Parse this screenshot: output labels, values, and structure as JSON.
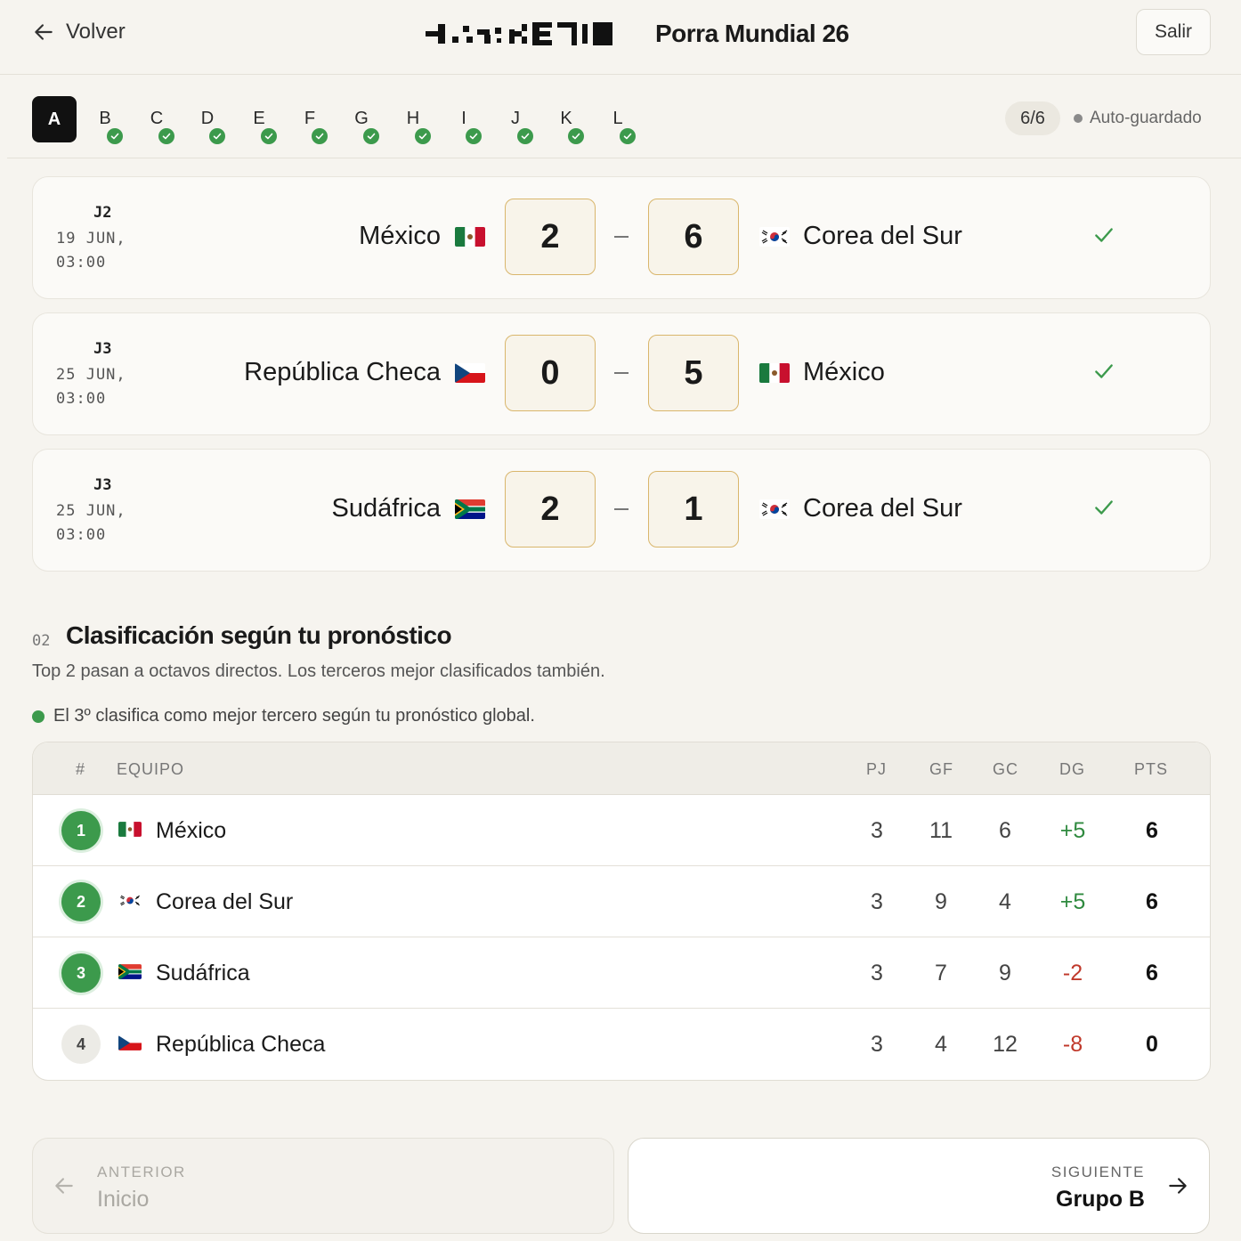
{
  "header": {
    "back_label": "Volver",
    "title": "Porra Mundial 26",
    "logout_label": "Salir"
  },
  "groups": {
    "tabs": [
      "A",
      "B",
      "C",
      "D",
      "E",
      "F",
      "G",
      "H",
      "I",
      "J",
      "K",
      "L"
    ],
    "active": "A",
    "completed": [
      "B",
      "C",
      "D",
      "E",
      "F",
      "G",
      "H",
      "I",
      "J",
      "K",
      "L"
    ],
    "counter": "6/6",
    "autosave": "Auto-guardado"
  },
  "matches": [
    {
      "round": "J2",
      "date": "19 JUN,",
      "time": "03:00",
      "home": "México",
      "home_flag": "mexico-flag-icon",
      "home_score": "2",
      "away_score": "6",
      "away": "Corea del Sur",
      "away_flag": "south-korea-flag-icon"
    },
    {
      "round": "J3",
      "date": "25 JUN,",
      "time": "03:00",
      "home": "República Checa",
      "home_flag": "czech-flag-icon",
      "home_score": "0",
      "away_score": "5",
      "away": "México",
      "away_flag": "mexico-flag-icon"
    },
    {
      "round": "J3",
      "date": "25 JUN,",
      "time": "03:00",
      "home": "Sudáfrica",
      "home_flag": "south-africa-flag-icon",
      "home_score": "2",
      "away_score": "1",
      "away": "Corea del Sur",
      "away_flag": "south-korea-flag-icon"
    }
  ],
  "standings": {
    "section_number": "02",
    "title": "Clasificación según tu pronóstico",
    "subtitle": "Top 2 pasan a octavos directos. Los terceros mejor clasificados también.",
    "note": "El 3º clasifica como mejor tercero según tu pronóstico global.",
    "columns": {
      "pos": "#",
      "team": "EQUIPO",
      "pj": "PJ",
      "gf": "GF",
      "gc": "GC",
      "dg": "DG",
      "pts": "PTS"
    },
    "rows": [
      {
        "pos": "1",
        "team": "México",
        "flag": "mexico-flag-icon",
        "pj": "3",
        "gf": "11",
        "gc": "6",
        "dg": "+5",
        "pts": "6",
        "qualified": true
      },
      {
        "pos": "2",
        "team": "Corea del Sur",
        "flag": "south-korea-flag-icon",
        "pj": "3",
        "gf": "9",
        "gc": "4",
        "dg": "+5",
        "pts": "6",
        "qualified": true
      },
      {
        "pos": "3",
        "team": "Sudáfrica",
        "flag": "south-africa-flag-icon",
        "pj": "3",
        "gf": "7",
        "gc": "9",
        "dg": "-2",
        "pts": "6",
        "qualified": true
      },
      {
        "pos": "4",
        "team": "República Checa",
        "flag": "czech-flag-icon",
        "pj": "3",
        "gf": "4",
        "gc": "12",
        "dg": "-8",
        "pts": "0",
        "qualified": false
      }
    ]
  },
  "pager": {
    "prev_small": "ANTERIOR",
    "prev_label": "Inicio",
    "next_small": "SIGUIENTE",
    "next_label": "Grupo B"
  },
  "colors": {
    "accent_green": "#3c9a4c",
    "score_border": "#d9b66c",
    "negative": "#c0392b",
    "background": "#f6f4ef"
  }
}
